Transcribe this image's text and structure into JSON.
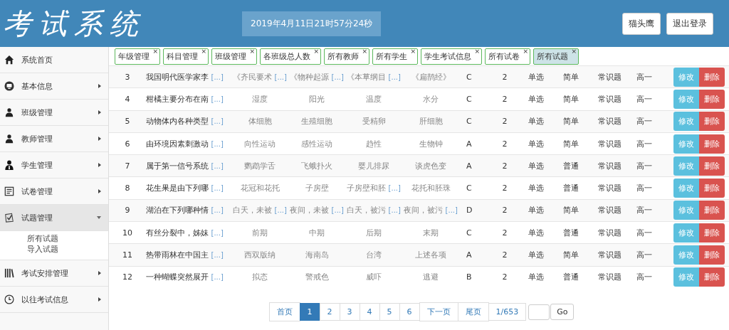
{
  "header": {
    "title": "考试系统",
    "datetime": "2019年4月11日21时57分24秒",
    "buttons": [
      "猫头鹰",
      "退出登录"
    ]
  },
  "sidebar": {
    "items": [
      {
        "label": "系统首页",
        "selected": false
      },
      {
        "label": "基本信息",
        "expanded": false,
        "selected": false
      },
      {
        "label": "班级管理",
        "expanded": false,
        "selected": false
      },
      {
        "label": "教师管理",
        "expanded": false,
        "selected": false
      },
      {
        "label": "学生管理",
        "expanded": false,
        "selected": false
      },
      {
        "label": "试卷管理",
        "expanded": false,
        "selected": false
      },
      {
        "label": "试题管理",
        "expanded": true,
        "selected": true,
        "children": [
          "所有试题",
          "导入试题"
        ]
      },
      {
        "label": "考试安排管理",
        "expanded": false,
        "selected": false
      },
      {
        "label": "以往考试信息",
        "expanded": false,
        "selected": false
      }
    ]
  },
  "tabs": [
    {
      "label": "年级管理",
      "selected": false,
      "close": "×"
    },
    {
      "label": "科目管理",
      "selected": false,
      "close": "×"
    },
    {
      "label": "班级管理",
      "selected": false,
      "close": "×"
    },
    {
      "label": "各班级总人数",
      "selected": false,
      "close": "×"
    },
    {
      "label": "所有教师",
      "selected": false,
      "close": "×"
    },
    {
      "label": "所有学生",
      "selected": false,
      "close": "×"
    },
    {
      "label": "学生考试信息",
      "selected": false,
      "close": "×"
    },
    {
      "label": "所有试卷",
      "selected": false,
      "close": "×"
    },
    {
      "label": "所有试题",
      "selected": true,
      "close": "×"
    }
  ],
  "table": {
    "rows": [
      {
        "no": "3",
        "stem": "我国明代医学家李",
        "more": "[...]",
        "options": [
          {
            "text": "《齐民要术",
            "more": "[...]"
          },
          {
            "text": "《物种起源",
            "more": "[...]"
          },
          {
            "text": "《本草纲目",
            "more": "[...]"
          },
          {
            "text": "《扁鹊经》"
          }
        ],
        "answer": "C",
        "score": "2",
        "type": "单选",
        "difficulty": "简单",
        "category": "常识题",
        "grade": "高一",
        "actions": [
          "修改",
          "删除"
        ]
      },
      {
        "no": "4",
        "stem": "柑橘主要分布在南",
        "more": "[...]",
        "options": [
          {
            "text": "湿度"
          },
          {
            "text": "阳光"
          },
          {
            "text": "温度"
          },
          {
            "text": "水分"
          }
        ],
        "answer": "C",
        "score": "2",
        "type": "单选",
        "difficulty": "简单",
        "category": "常识题",
        "grade": "高一",
        "actions": [
          "修改",
          "删除"
        ]
      },
      {
        "no": "5",
        "stem": "动物体内各种类型",
        "more": "[...]",
        "options": [
          {
            "text": "体细胞"
          },
          {
            "text": "生殖细胞"
          },
          {
            "text": "受精卵"
          },
          {
            "text": "肝细胞"
          }
        ],
        "answer": "C",
        "score": "2",
        "type": "单选",
        "difficulty": "简单",
        "category": "常识题",
        "grade": "高一",
        "actions": [
          "修改",
          "删除"
        ]
      },
      {
        "no": "6",
        "stem": "由环境因素刺激动",
        "more": "[...]",
        "options": [
          {
            "text": "向性运动"
          },
          {
            "text": "感性运动"
          },
          {
            "text": "趋性"
          },
          {
            "text": "生物钟"
          }
        ],
        "answer": "A",
        "score": "2",
        "type": "单选",
        "difficulty": "简单",
        "category": "常识题",
        "grade": "高一",
        "actions": [
          "修改",
          "删除"
        ]
      },
      {
        "no": "7",
        "stem": "属于第一信号系统",
        "more": "[...]",
        "options": [
          {
            "text": "鹦鹉学舌"
          },
          {
            "text": "飞蛾扑火"
          },
          {
            "text": "婴儿排尿"
          },
          {
            "text": "谈虎色变"
          }
        ],
        "answer": "A",
        "score": "2",
        "type": "单选",
        "difficulty": "普通",
        "category": "常识题",
        "grade": "高一",
        "actions": [
          "修改",
          "删除"
        ]
      },
      {
        "no": "8",
        "stem": "花生果是由下列哪",
        "more": "[...]",
        "options": [
          {
            "text": "花冠和花托"
          },
          {
            "text": "子房壁"
          },
          {
            "text": "子房壁和胚",
            "more": "[...]"
          },
          {
            "text": "花托和胚珠"
          }
        ],
        "answer": "C",
        "score": "2",
        "type": "单选",
        "difficulty": "普通",
        "category": "常识题",
        "grade": "高一",
        "actions": [
          "修改",
          "删除"
        ]
      },
      {
        "no": "9",
        "stem": "湖泊在下列哪种情",
        "more": "[...]",
        "options": [
          {
            "text": "白天，未被",
            "more": "[...]"
          },
          {
            "text": "夜间，未被",
            "more": "[...]"
          },
          {
            "text": "白天，被污",
            "more": "[...]"
          },
          {
            "text": "夜间，被污",
            "more": "[...]"
          }
        ],
        "answer": "D",
        "score": "2",
        "type": "单选",
        "difficulty": "简单",
        "category": "常识题",
        "grade": "高一",
        "actions": [
          "修改",
          "删除"
        ]
      },
      {
        "no": "10",
        "stem": "有丝分裂中，姊妹",
        "more": "[...]",
        "options": [
          {
            "text": "前期"
          },
          {
            "text": "中期"
          },
          {
            "text": "后期"
          },
          {
            "text": "末期"
          }
        ],
        "answer": "C",
        "score": "2",
        "type": "单选",
        "difficulty": "普通",
        "category": "常识题",
        "grade": "高一",
        "actions": [
          "修改",
          "删除"
        ]
      },
      {
        "no": "11",
        "stem": "热带雨林在中国主",
        "more": "[...]",
        "options": [
          {
            "text": "西双版纳"
          },
          {
            "text": "海南岛"
          },
          {
            "text": "台湾"
          },
          {
            "text": "上述各项"
          }
        ],
        "answer": "A",
        "score": "2",
        "type": "单选",
        "difficulty": "简单",
        "category": "常识题",
        "grade": "高一",
        "actions": [
          "修改",
          "删除"
        ]
      },
      {
        "no": "12",
        "stem": "一种蝴蝶突然展开",
        "more": "[...]",
        "options": [
          {
            "text": "拟态"
          },
          {
            "text": "警戒色"
          },
          {
            "text": "威吓"
          },
          {
            "text": "逃避"
          }
        ],
        "answer": "B",
        "score": "2",
        "type": "单选",
        "difficulty": "普通",
        "category": "常识题",
        "grade": "高一",
        "actions": [
          "修改",
          "删除"
        ]
      }
    ]
  },
  "pagination": {
    "pages": [
      {
        "label": "首页",
        "selected": false
      },
      {
        "label": "1",
        "selected": true
      },
      {
        "label": "2",
        "selected": false
      },
      {
        "label": "3",
        "selected": false
      },
      {
        "label": "4",
        "selected": false
      },
      {
        "label": "5",
        "selected": false
      },
      {
        "label": "6",
        "selected": false
      },
      {
        "label": "下一页",
        "selected": false
      },
      {
        "label": "尾页",
        "selected": false
      }
    ],
    "counter": "1/653",
    "go": "Go"
  }
}
